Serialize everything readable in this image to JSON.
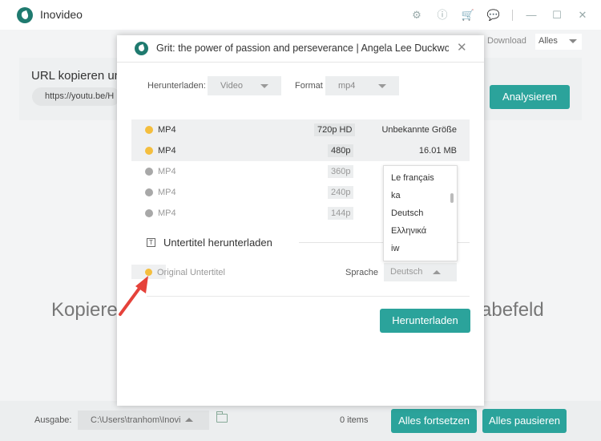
{
  "app": {
    "title": "Inovideo"
  },
  "topbar": {
    "download_label": "Download",
    "filter_value": "Alles"
  },
  "url_panel": {
    "title": "URL kopieren un",
    "url_value": "https://youtu.be/H",
    "analyze_label": "Analysieren"
  },
  "main": {
    "hint_left": "Kopiere",
    "hint_right": "abefeld"
  },
  "bottom": {
    "output_label": "Ausgabe:",
    "path": "C:\\Users\\tranhom\\Inovi",
    "items_count": "0 items",
    "resume_all": "Alles fortsetzen",
    "pause_all": "Alles pausieren"
  },
  "dialog": {
    "title": "Grit: the power of passion and perseverance | Angela Lee Duckworth",
    "close_symbol": "✕",
    "download_type_label": "Herunterladen:",
    "download_type_value": "Video",
    "format_label": "Format",
    "format_value": "mp4",
    "rows": [
      {
        "format": "MP4",
        "resolution": "720p HD",
        "size": "Unbekannte Größe",
        "enabled": true
      },
      {
        "format": "MP4",
        "resolution": "480p",
        "size": "16.01 MB",
        "enabled": true
      },
      {
        "format": "MP4",
        "resolution": "360p",
        "size": "",
        "enabled": false
      },
      {
        "format": "MP4",
        "resolution": "240p",
        "size": "",
        "enabled": false
      },
      {
        "format": "MP4",
        "resolution": "144p",
        "size": "",
        "enabled": false
      }
    ],
    "subtitle_icon": "T",
    "subtitle_title": "Untertitel herunterladen",
    "original_subtitle": "Original Untertitel",
    "language_label": "Sprache",
    "language_value": "Deutsch",
    "language_options": [
      "Le français",
      "ka",
      "Deutsch",
      "Ελληνικά",
      "iw"
    ],
    "download_button": "Herunterladen"
  },
  "colors": {
    "accent": "#2ba39b",
    "dot_active": "#f4be3e",
    "dot_inactive": "#a8a8a8",
    "annotation_arrow": "#e5423a"
  }
}
